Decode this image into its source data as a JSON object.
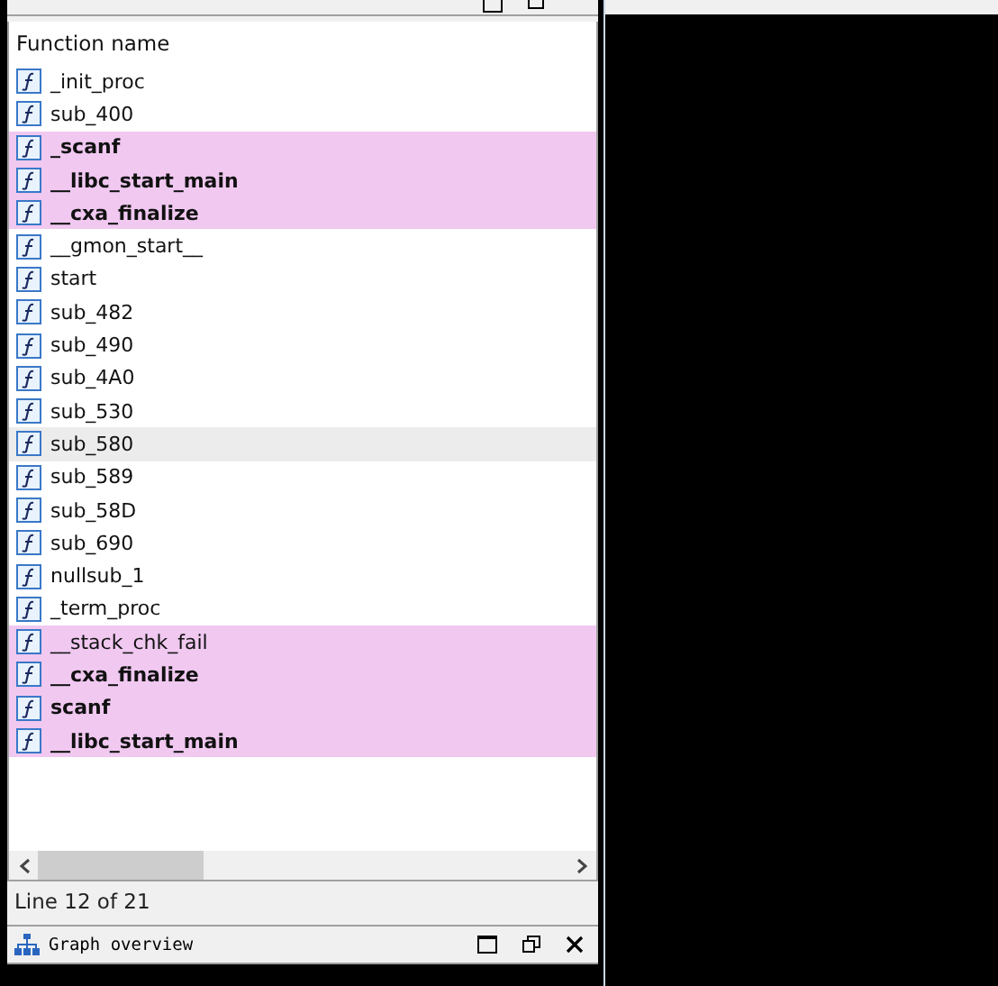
{
  "functions_window": {
    "column_header": "Function name",
    "functions": [
      {
        "name": "_init_proc",
        "imported": false,
        "bold": false,
        "selected": false
      },
      {
        "name": "sub_400",
        "imported": false,
        "bold": false,
        "selected": false
      },
      {
        "name": "_scanf",
        "imported": true,
        "bold": true,
        "selected": false
      },
      {
        "name": "__libc_start_main",
        "imported": true,
        "bold": true,
        "selected": false
      },
      {
        "name": "__cxa_finalize",
        "imported": true,
        "bold": true,
        "selected": false
      },
      {
        "name": "__gmon_start__",
        "imported": false,
        "bold": false,
        "selected": false
      },
      {
        "name": "start",
        "imported": false,
        "bold": false,
        "selected": false
      },
      {
        "name": "sub_482",
        "imported": false,
        "bold": false,
        "selected": false
      },
      {
        "name": "sub_490",
        "imported": false,
        "bold": false,
        "selected": false
      },
      {
        "name": "sub_4A0",
        "imported": false,
        "bold": false,
        "selected": false
      },
      {
        "name": "sub_530",
        "imported": false,
        "bold": false,
        "selected": false
      },
      {
        "name": "sub_580",
        "imported": false,
        "bold": false,
        "selected": true
      },
      {
        "name": "sub_589",
        "imported": false,
        "bold": false,
        "selected": false
      },
      {
        "name": "sub_58D",
        "imported": false,
        "bold": false,
        "selected": false
      },
      {
        "name": "sub_690",
        "imported": false,
        "bold": false,
        "selected": false
      },
      {
        "name": "nullsub_1",
        "imported": false,
        "bold": false,
        "selected": false
      },
      {
        "name": "_term_proc",
        "imported": false,
        "bold": false,
        "selected": false
      },
      {
        "name": "__stack_chk_fail",
        "imported": true,
        "bold": false,
        "selected": false
      },
      {
        "name": "__cxa_finalize",
        "imported": true,
        "bold": true,
        "selected": false
      },
      {
        "name": "scanf",
        "imported": true,
        "bold": true,
        "selected": false
      },
      {
        "name": "__libc_start_main",
        "imported": true,
        "bold": true,
        "selected": false
      }
    ],
    "status": "Line 12 of 21"
  },
  "graph_overview": {
    "title": "Graph overview"
  }
}
